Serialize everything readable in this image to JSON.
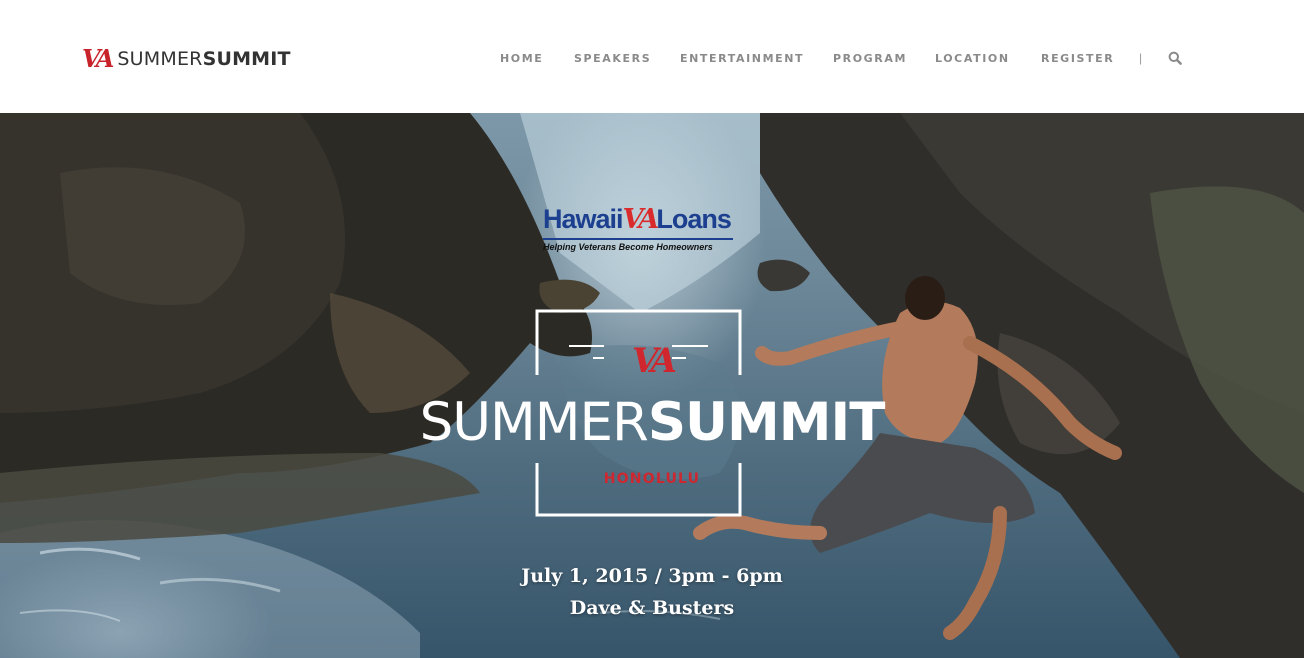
{
  "header": {
    "logo": {
      "mark": "VA",
      "name_light": "SUMMER",
      "name_bold": "SUMMIT"
    },
    "nav": [
      {
        "label": "HOME"
      },
      {
        "label": "SPEAKERS"
      },
      {
        "label": "ENTERTAINMENT"
      },
      {
        "label": "PROGRAM"
      },
      {
        "label": "LOCATION"
      },
      {
        "label": "REGISTER"
      }
    ],
    "separator": "|",
    "search_icon": "search-icon"
  },
  "hero": {
    "sponsor": {
      "name_left": "Hawaii",
      "name_mark": "VA",
      "name_right": "Loans",
      "tagline": "Helping Veterans Become Homeowners"
    },
    "emblem": {
      "mark": "VA",
      "title_light": "SUMMER",
      "title_bold": "SUMMIT",
      "city": "HONOLULU"
    },
    "event": {
      "date_time": "July 1, 2015 / 3pm - 6pm",
      "venue": "Dave & Busters"
    }
  },
  "colors": {
    "brand_red": "#d0262d",
    "sponsor_blue": "#1c3f8f",
    "nav_gray": "#8a8a8a"
  }
}
